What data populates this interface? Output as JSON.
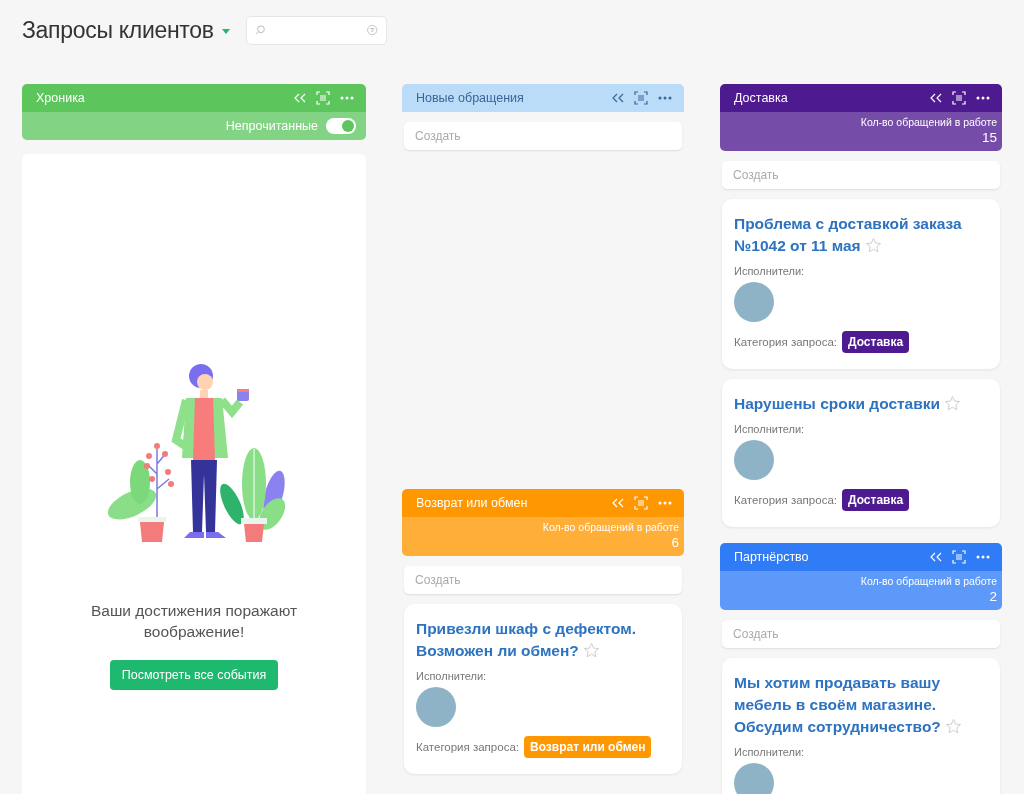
{
  "page": {
    "title": "Запросы клиентов"
  },
  "timeline": {
    "title": "Хроника",
    "filter_label": "Непрочитанные",
    "filter_on": true,
    "message": "Ваши достижения поражают воображение!",
    "button": "Посмотреть все события"
  },
  "columns": [
    {
      "groups": [
        {
          "title": "Новые обращения",
          "color": "#bbdcf9",
          "create_placeholder": "Создать"
        },
        {
          "title": "Возврат или обмен",
          "color": "#ff9800",
          "count_label": "Кол-во обращений в работе",
          "count": "6",
          "create_placeholder": "Создать",
          "cards": [
            {
              "title": "Привезли шкаф с дефектом. Возможен ли обмен?",
              "starred": false,
              "assignees_label": "Исполнители:",
              "assignees": [
                {
                  "kind": "photo"
                }
              ],
              "category_label": "Категория запроса:",
              "category": "Возврат или обмен"
            }
          ]
        }
      ]
    },
    {
      "groups": [
        {
          "title": "Доставка",
          "color": "#4e1a8f",
          "count_label": "Кол-во обращений в работе",
          "count": "15",
          "create_placeholder": "Создать",
          "cards": [
            {
              "title": "Проблема с доставкой заказа №1042 от 11 мая",
              "starred": false,
              "assignees_label": "Исполнители:",
              "assignees": [
                {
                  "kind": "photo"
                }
              ],
              "category_label": "Категория запроса:",
              "category": "Доставка"
            },
            {
              "title": "Нарушены сроки доставки",
              "starred": false,
              "assignees_label": "Исполнители:",
              "assignees": [
                {
                  "kind": "photo"
                }
              ],
              "category_label": "Категория запроса:",
              "category": "Доставка"
            }
          ]
        },
        {
          "title": "Партнёрство",
          "color": "#2f7cf6",
          "count_label": "Кол-во обращений в работе",
          "count": "2",
          "create_placeholder": "Создать",
          "cards": [
            {
              "title": "Мы хотим продавать вашу мебель в своём магазине. Обсудим сотрудничество?",
              "starred": false,
              "assignees_label": "Исполнители:",
              "assignees": [
                {
                  "kind": "photo"
                }
              ]
            }
          ]
        }
      ]
    }
  ]
}
